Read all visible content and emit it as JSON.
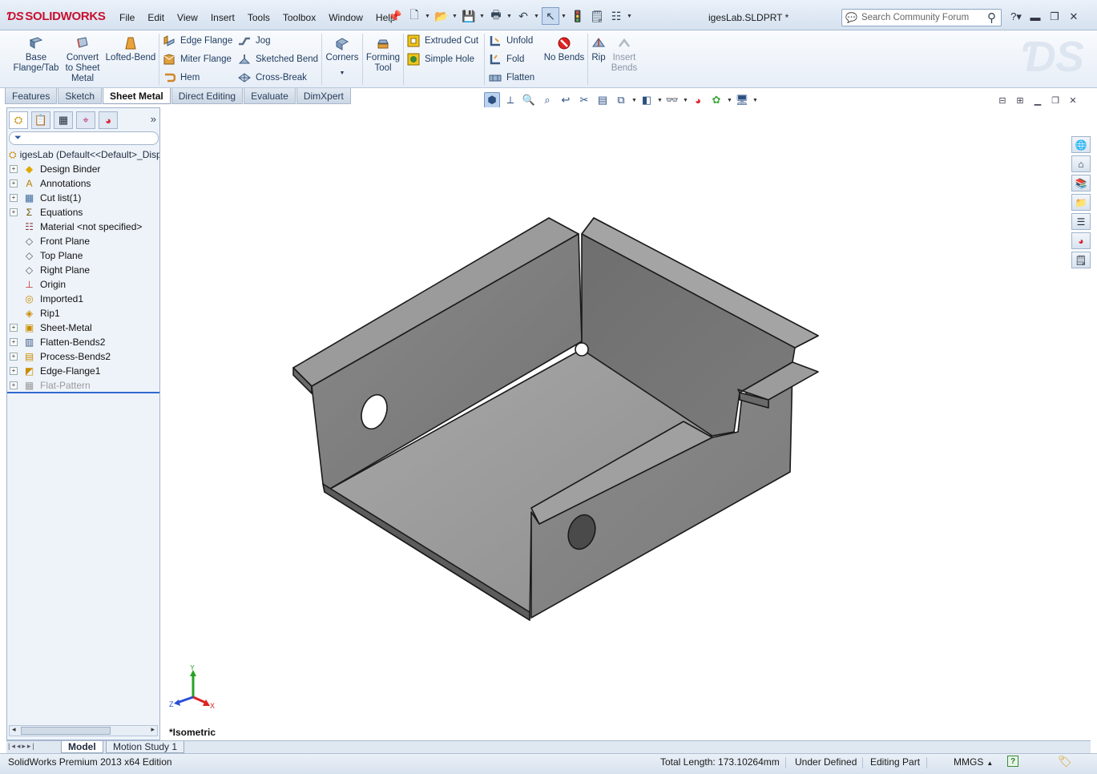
{
  "app": {
    "logo": "SOLIDWORKS",
    "document_title": "igesLab.SLDPRT *",
    "search_placeholder": "Search Community Forum"
  },
  "menu": [
    "File",
    "Edit",
    "View",
    "Insert",
    "Tools",
    "Toolbox",
    "Window",
    "Help"
  ],
  "ribbon": {
    "base_flange": "Base Flange/Tab",
    "convert_sheet": "Convert to Sheet Metal",
    "lofted_bend": "Lofted-Bend",
    "edge_flange": "Edge Flange",
    "miter_flange": "Miter Flange",
    "hem": "Hem",
    "jog": "Jog",
    "sketched_bend": "Sketched Bend",
    "cross_break": "Cross-Break",
    "corners": "Corners",
    "forming_tool": "Forming Tool",
    "extruded_cut": "Extruded Cut",
    "simple_hole": "Simple Hole",
    "unfold": "Unfold",
    "fold": "Fold",
    "flatten": "Flatten",
    "no_bends": "No Bends",
    "rip": "Rip",
    "insert_bends": "Insert Bends"
  },
  "command_tabs": [
    "Features",
    "Sketch",
    "Sheet Metal",
    "Direct Editing",
    "Evaluate",
    "DimXpert"
  ],
  "active_command_tab": "Sheet Metal",
  "tree": {
    "root": "igesLab  (Default<<Default>_Display State 1>)",
    "items": [
      {
        "label": "Design Binder",
        "expandable": true,
        "icon": "binder-icon"
      },
      {
        "label": "Annotations",
        "expandable": true,
        "icon": "annotations-icon"
      },
      {
        "label": "Cut list(1)",
        "expandable": true,
        "icon": "cut-list-icon"
      },
      {
        "label": "Equations",
        "expandable": true,
        "icon": "equations-icon"
      },
      {
        "label": "Material <not specified>",
        "expandable": false,
        "icon": "material-icon"
      },
      {
        "label": "Front Plane",
        "expandable": false,
        "icon": "plane-icon"
      },
      {
        "label": "Top Plane",
        "expandable": false,
        "icon": "plane-icon"
      },
      {
        "label": "Right Plane",
        "expandable": false,
        "icon": "plane-icon"
      },
      {
        "label": "Origin",
        "expandable": false,
        "icon": "origin-icon"
      },
      {
        "label": "Imported1",
        "expandable": false,
        "icon": "imported-icon"
      },
      {
        "label": "Rip1",
        "expandable": false,
        "icon": "rip-icon"
      },
      {
        "label": "Sheet-Metal",
        "expandable": true,
        "icon": "sheet-metal-icon"
      },
      {
        "label": "Flatten-Bends2",
        "expandable": true,
        "icon": "flatten-bends-icon"
      },
      {
        "label": "Process-Bends2",
        "expandable": true,
        "icon": "process-bends-icon"
      },
      {
        "label": "Edge-Flange1",
        "expandable": true,
        "icon": "edge-flange-icon"
      },
      {
        "label": "Flat-Pattern",
        "expandable": true,
        "icon": "flat-pattern-icon",
        "suppressed": true
      }
    ]
  },
  "view": {
    "name": "*Isometric",
    "triad_labels": {
      "x": "X",
      "y": "Y",
      "z": "Z"
    }
  },
  "bottom_tabs": [
    "Model",
    "Motion Study 1"
  ],
  "active_bottom_tab": "Model",
  "status": {
    "edition": "SolidWorks Premium 2013 x64 Edition",
    "total_length": "Total Length: 173.10264mm",
    "definition": "Under Defined",
    "mode": "Editing Part",
    "units": "MMGS",
    "help": "?"
  },
  "colors": {
    "titlebar": "#dde8f4",
    "ribbon": "#eef3f9",
    "tree_bg": "#eef3fa",
    "part_face_light": "#9a9a9a",
    "part_face_dark": "#6e6e6e",
    "accent_blue": "#2f6bd0",
    "logo_red": "#c8102e"
  }
}
